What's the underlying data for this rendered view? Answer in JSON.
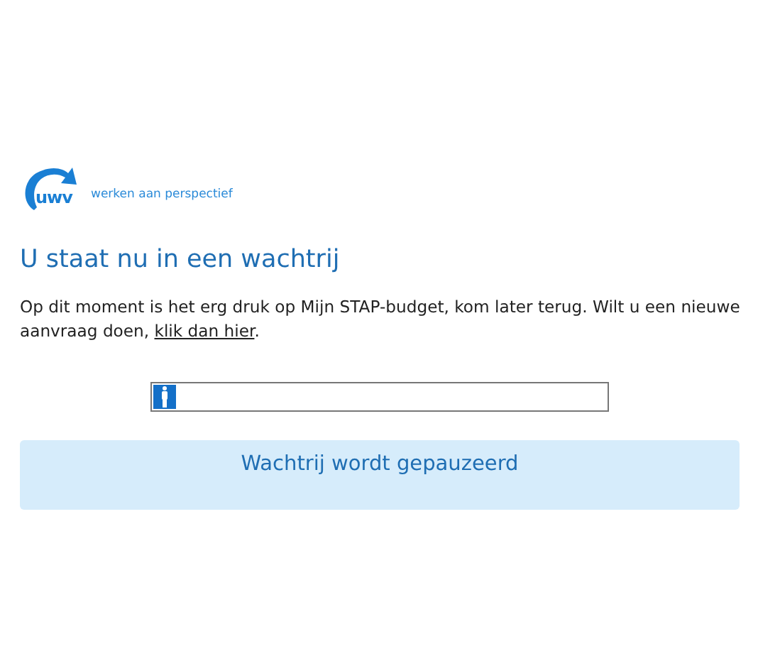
{
  "logo": {
    "mark": "uwv",
    "tagline": "werken aan perspectief"
  },
  "heading": "U staat nu in een wachtrij",
  "message": {
    "before": "Op dit moment is het erg druk op Mijn STAP-budget, kom later terug. Wilt u een nieuwe aanvraag doen, ",
    "link": "klik dan hier",
    "after": "."
  },
  "queue": {
    "level": 0.05
  },
  "status": "Wachtrij wordt gepauzeerd"
}
